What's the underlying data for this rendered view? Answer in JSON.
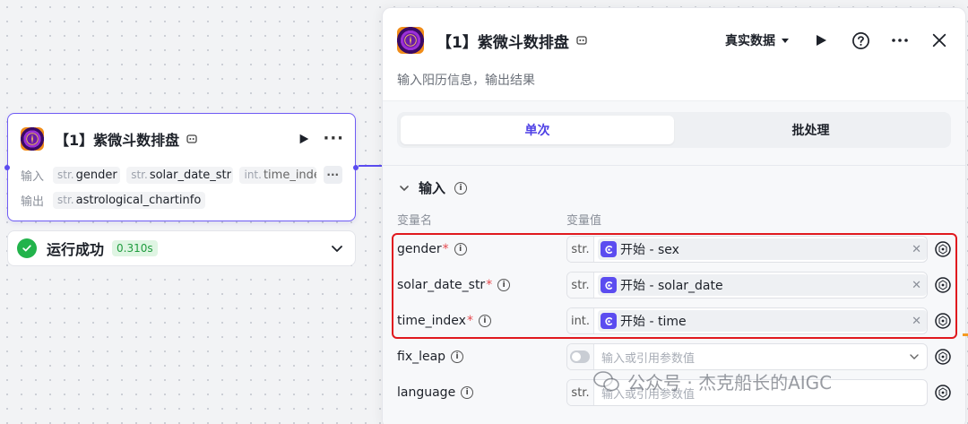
{
  "node": {
    "title": "【1】紫微斗数排盘",
    "input_label": "输入",
    "output_label": "输出",
    "inputs": [
      {
        "type": "str.",
        "name": "gender"
      },
      {
        "type": "str.",
        "name": "solar_date_str"
      },
      {
        "type": "int.",
        "name": "time_inde"
      }
    ],
    "outputs": [
      {
        "type": "str.",
        "name": "astrological_chartinfo"
      }
    ]
  },
  "status": {
    "text": "运行成功",
    "duration": "0.310s"
  },
  "panel": {
    "title": "【1】紫微斗数排盘",
    "data_mode": "真实数据",
    "description": "输入阳历信息，输出结果",
    "tabs": [
      {
        "label": "单次",
        "active": true
      },
      {
        "label": "批处理",
        "active": false
      }
    ],
    "section_title": "输入",
    "col_name": "变量名",
    "col_value": "变量值",
    "rows": [
      {
        "name": "gender",
        "required": "*",
        "type": "str.",
        "ref": "开始 - sex"
      },
      {
        "name": "solar_date_str",
        "required": "*",
        "type": "str.",
        "ref": "开始 - solar_date"
      },
      {
        "name": "time_index",
        "required": "*",
        "type": "int.",
        "ref": "开始 - time"
      },
      {
        "name": "fix_leap",
        "required": "",
        "type": "toggle",
        "placeholder": "输入或引用参数值"
      },
      {
        "name": "language",
        "required": "",
        "type": "str.",
        "placeholder": "输入或引用参数值"
      }
    ]
  },
  "watermark": "公众号 · 杰克船长的AIGC",
  "colors": {
    "accent": "#5b4cf0",
    "success": "#22b34b",
    "highlight": "#e0191e",
    "required": "#e5484d"
  }
}
